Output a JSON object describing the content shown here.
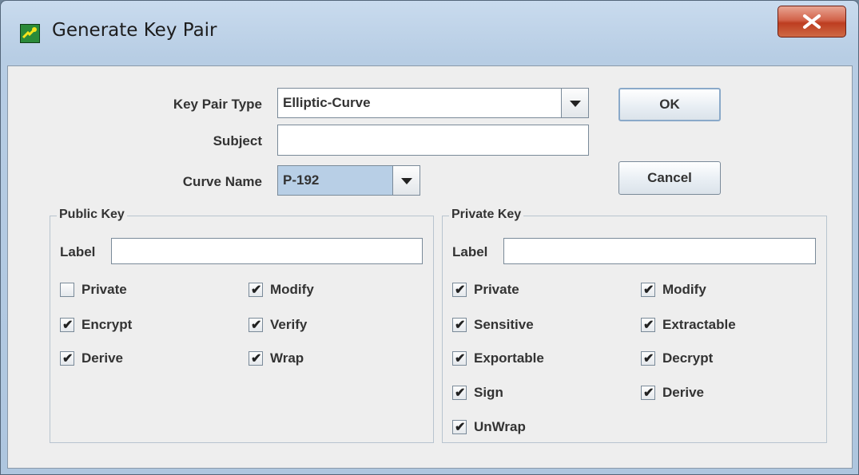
{
  "window": {
    "title": "Generate Key Pair"
  },
  "form": {
    "key_pair_type_label": "Key Pair Type",
    "key_pair_type_value": "Elliptic-Curve",
    "subject_label": "Subject",
    "subject_value": "",
    "curve_name_label": "Curve Name",
    "curve_name_value": "P-192"
  },
  "buttons": {
    "ok": "OK",
    "cancel": "Cancel"
  },
  "public_key": {
    "legend": "Public Key",
    "label_label": "Label",
    "label_value": "",
    "checkboxes": [
      {
        "label": "Private",
        "checked": false
      },
      {
        "label": "Modify",
        "checked": true
      },
      {
        "label": "Encrypt",
        "checked": true
      },
      {
        "label": "Verify",
        "checked": true
      },
      {
        "label": "Derive",
        "checked": true
      },
      {
        "label": "Wrap",
        "checked": true
      }
    ]
  },
  "private_key": {
    "legend": "Private Key",
    "label_label": "Label",
    "label_value": "",
    "checkboxes": [
      {
        "label": "Private",
        "checked": true
      },
      {
        "label": "Modify",
        "checked": true
      },
      {
        "label": "Sensitive",
        "checked": true
      },
      {
        "label": "Extractable",
        "checked": true
      },
      {
        "label": "Exportable",
        "checked": true
      },
      {
        "label": "Decrypt",
        "checked": true
      },
      {
        "label": "Sign",
        "checked": true
      },
      {
        "label": "Derive",
        "checked": true
      },
      {
        "label": "UnWrap",
        "checked": true
      }
    ]
  },
  "check_mark": "✔"
}
